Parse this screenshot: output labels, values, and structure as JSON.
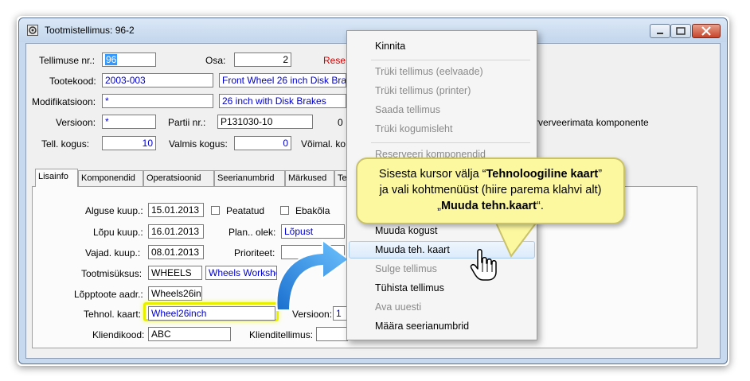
{
  "window": {
    "title": "Tootmistellimus: 96-2"
  },
  "header": {
    "order_no_label": "Tellimuse nr.:",
    "order_no": "96",
    "part_label": "Osa:",
    "part": "2",
    "reserve_text": "Rese",
    "product_code_label": "Tootekood:",
    "product_code": "2003-003",
    "product_desc": "Front Wheel 26 inch Disk Bral",
    "modification_label": "Modifikatsioon:",
    "modification": "*",
    "modification_desc": "26 inch with Disk Brakes",
    "version_label": "Versioon:",
    "version": "*",
    "batch_label": "Partii nr.:",
    "batch": "P131030-10",
    "batch_extra": "0",
    "unreserved_text": "rverveerimata komponente",
    "qty_label": "Tell. kogus:",
    "qty": "10",
    "done_qty_label": "Valmis kogus:",
    "done_qty": "0",
    "possible_label": "Võimal. ko"
  },
  "tabs": [
    "Lisainfo",
    "Komponendid",
    "Operatsioonid",
    "Seerianumbrid",
    "Märkused",
    "Te"
  ],
  "lisainfo": {
    "start_label": "Alguse kuup.:",
    "start": "15.01.2013",
    "paused_label": "Peatatud",
    "conflict_label": "Ebakõla",
    "end_label": "Lõpu kuup.:",
    "end": "16.01.2013",
    "plan_state_label": "Plan.. olek:",
    "plan_state": "Lõpust",
    "needed_label": "Vajad. kuup.:",
    "needed": "08.01.2013",
    "priority_label": "Prioriteet:",
    "unit_label": "Tootmisüksus:",
    "unit": "WHEELS",
    "unit_desc": "Wheels Worksho",
    "final_addr_label": "Lõpptoote aadr.:",
    "final_addr": "Wheels26inc",
    "tech_card_label": "Tehnol. kaart:",
    "tech_card": "Wheel26inch",
    "version_label": "Versioon:",
    "version": "1",
    "customer_code_label": "Kliendikood:",
    "customer_code": "ABC",
    "customer_order_label": "Klienditellimus:"
  },
  "context_menu": {
    "items": [
      {
        "label": "Kinnita",
        "enabled": true
      },
      {
        "label": "Trüki tellimus (eelvaade)",
        "enabled": false
      },
      {
        "label": "Trüki tellimus (printer)",
        "enabled": false
      },
      {
        "label": "Saada tellimus",
        "enabled": false
      },
      {
        "label": "Trüki kogumisleht",
        "enabled": false
      },
      {
        "label": "Reserveeri komponendid",
        "enabled": false
      },
      {
        "label": "Muuda kogust",
        "enabled": true
      },
      {
        "label": "Muuda teh. kaart",
        "enabled": true
      },
      {
        "label": "Sulge tellimus",
        "enabled": false
      },
      {
        "label": "Tühista tellimus",
        "enabled": true
      },
      {
        "label": "Ava uuesti",
        "enabled": false
      },
      {
        "label": "Määra seerianumbrid",
        "enabled": true
      }
    ]
  },
  "callout": {
    "line1_pre": "Sisesta kursor välja “",
    "line1_bold": "Tehnoloogiline kaart",
    "line1_post": "”",
    "line2": "ja vali kohtmenüüst (hiire parema klahvi alt)",
    "line3_pre": "„",
    "line3_bold": "Muuda tehn.kaart",
    "line3_post": "“."
  },
  "colors": {
    "accent_blue": "#0000cc",
    "highlight": "#e6f000",
    "callout_bg": "#fcf8a0",
    "arrow": "#2a8fe0",
    "reserve_red": "#cc0000"
  }
}
